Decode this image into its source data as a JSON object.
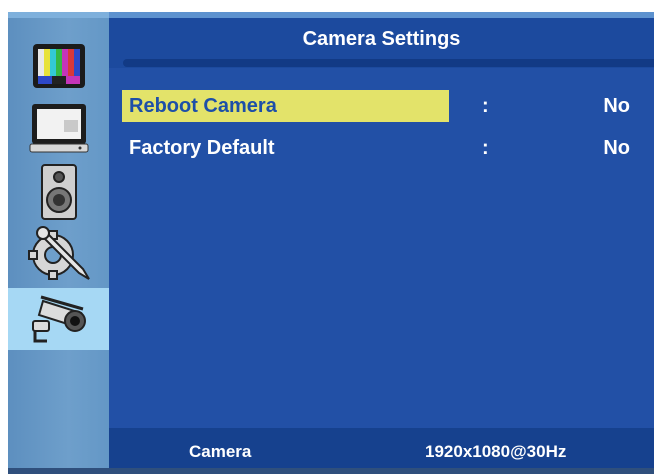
{
  "menu": {
    "title": "Camera Settings",
    "items": [
      {
        "label": "Reboot Camera",
        "separator": ":",
        "value": "No",
        "selected": true
      },
      {
        "label": "Factory Default",
        "separator": ":",
        "value": "No",
        "selected": false
      }
    ]
  },
  "sidebar": {
    "icons": [
      "picture-icon",
      "monitor-icon",
      "speaker-icon",
      "tools-icon",
      "camera-icon"
    ],
    "active": "camera-icon"
  },
  "footer": {
    "section": "Camera",
    "resolution": "1920x1080@30Hz"
  },
  "colors": {
    "background": "#2250a6",
    "highlight": "#e3e36a",
    "rail": "#6e9fcb",
    "rail_active": "#a6d8f4"
  }
}
